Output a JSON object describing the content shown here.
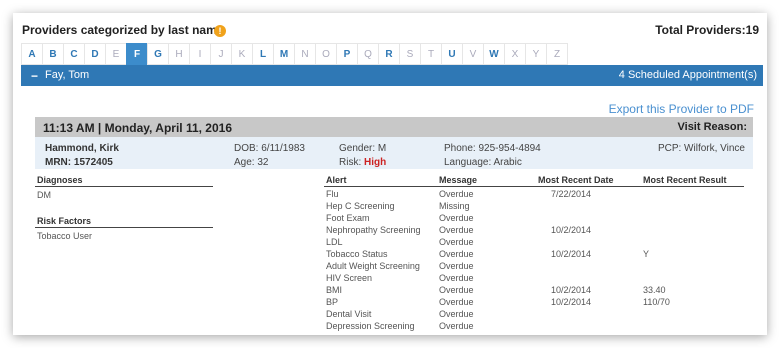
{
  "header": {
    "title": "Providers categorized by last name",
    "info_glyph": "!",
    "total": "Total Providers:19"
  },
  "letters": [
    {
      "label": "A",
      "state": "active"
    },
    {
      "label": "B",
      "state": "active"
    },
    {
      "label": "C",
      "state": "active"
    },
    {
      "label": "D",
      "state": "active"
    },
    {
      "label": "E",
      "state": "inactive"
    },
    {
      "label": "F",
      "state": "selected"
    },
    {
      "label": "G",
      "state": "active"
    },
    {
      "label": "H",
      "state": "inactive"
    },
    {
      "label": "I",
      "state": "inactive"
    },
    {
      "label": "J",
      "state": "inactive"
    },
    {
      "label": "K",
      "state": "inactive"
    },
    {
      "label": "L",
      "state": "active"
    },
    {
      "label": "M",
      "state": "active"
    },
    {
      "label": "N",
      "state": "inactive"
    },
    {
      "label": "O",
      "state": "inactive"
    },
    {
      "label": "P",
      "state": "active"
    },
    {
      "label": "Q",
      "state": "inactive"
    },
    {
      "label": "R",
      "state": "active"
    },
    {
      "label": "S",
      "state": "inactive"
    },
    {
      "label": "T",
      "state": "inactive"
    },
    {
      "label": "U",
      "state": "active"
    },
    {
      "label": "V",
      "state": "inactive"
    },
    {
      "label": "W",
      "state": "active"
    },
    {
      "label": "X",
      "state": "inactive"
    },
    {
      "label": "Y",
      "state": "inactive"
    },
    {
      "label": "Z",
      "state": "inactive"
    }
  ],
  "provider": {
    "toggle_glyph": "−",
    "name": "Fay, Tom",
    "appointments": "4 Scheduled Appointment(s)",
    "export_label": "Export this Provider to PDF"
  },
  "visit": {
    "datetime": "11:13 AM | Monday, April 11, 2016",
    "reason_label": "Visit Reason:"
  },
  "patient": {
    "name": "Hammond, Kirk",
    "mrn": "MRN: 1572405",
    "dob": "DOB: 6/11/1983",
    "age": "Age: 32",
    "gender": "Gender: M",
    "risk_label": "Risk: ",
    "risk_value": "High",
    "phone": "Phone: 925-954-4894",
    "language": "Language: Arabic",
    "pcp": "PCP: Wilfork, Vince"
  },
  "diagnoses": {
    "heading": "Diagnoses",
    "items": [
      "DM"
    ]
  },
  "risk_factors": {
    "heading": "Risk Factors",
    "items": [
      "Tobacco User"
    ]
  },
  "alerts": {
    "headers": {
      "alert": "Alert",
      "message": "Message",
      "date": "Most Recent Date",
      "result": "Most Recent Result"
    },
    "rows": [
      {
        "alert": "Flu",
        "message": "Overdue",
        "date": "7/22/2014",
        "result": ""
      },
      {
        "alert": "Hep C Screening",
        "message": "Missing",
        "date": "",
        "result": ""
      },
      {
        "alert": "Foot Exam",
        "message": "Overdue",
        "date": "",
        "result": ""
      },
      {
        "alert": "Nephropathy Screening",
        "message": "Overdue",
        "date": "10/2/2014",
        "result": ""
      },
      {
        "alert": "LDL",
        "message": "Overdue",
        "date": "",
        "result": ""
      },
      {
        "alert": "Tobacco Status",
        "message": "Overdue",
        "date": "10/2/2014",
        "result": "Y"
      },
      {
        "alert": "Adult Weight Screening",
        "message": "Overdue",
        "date": "",
        "result": ""
      },
      {
        "alert": "HIV Screen",
        "message": "Overdue",
        "date": "",
        "result": ""
      },
      {
        "alert": "BMI",
        "message": "Overdue",
        "date": "10/2/2014",
        "result": "33.40"
      },
      {
        "alert": "BP",
        "message": "Overdue",
        "date": "10/2/2014",
        "result": "110/70"
      },
      {
        "alert": "Dental Visit",
        "message": "Overdue",
        "date": "",
        "result": ""
      },
      {
        "alert": "Depression Screening",
        "message": "Overdue",
        "date": "",
        "result": ""
      }
    ]
  }
}
